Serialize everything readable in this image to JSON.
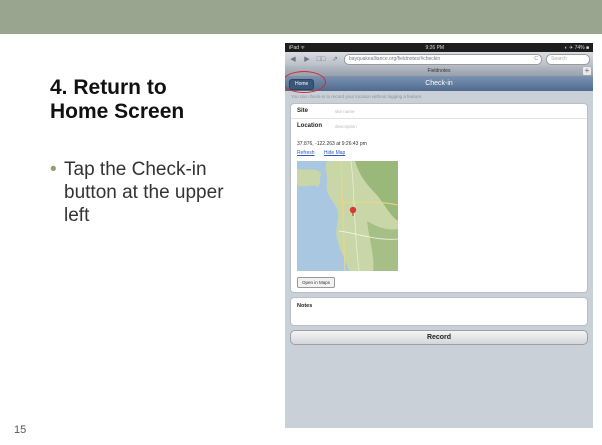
{
  "slide": {
    "title": "4. Return to\nHome Screen",
    "bullet": "Tap the Check-in button at the upper left",
    "number": "15"
  },
  "ipad": {
    "status": {
      "left": "iPad ᯤ",
      "time": "9:26 PM",
      "right": "◐ ✈ 74% ■"
    },
    "browser": {
      "back": "◀",
      "forward": "▶",
      "bookmarks": "□□",
      "share": "⇗",
      "url": "bayquakealliance.org/fieldnotes/#checkin",
      "reload": "C",
      "search_placeholder": "Search",
      "tab_title": "Fieldnotes",
      "new_tab": "+"
    },
    "app": {
      "home_label": "Home",
      "header_title": "Check-in",
      "hint": "You can check-in to record your location without logging a feature.",
      "site_label": "Site",
      "site_placeholder": "site name",
      "location_label": "Location",
      "location_placeholder": "description",
      "coordinates": "37.876, -122.263 at 9:26:43 pm",
      "refresh": "Refresh",
      "hide_map": "Hide Map",
      "open_maps": "Open in Maps",
      "notes_label": "Notes",
      "record_label": "Record"
    },
    "colors": {
      "header": "#5b7596",
      "highlight_circle": "#d42a2a",
      "link": "#2d5bb6"
    }
  }
}
